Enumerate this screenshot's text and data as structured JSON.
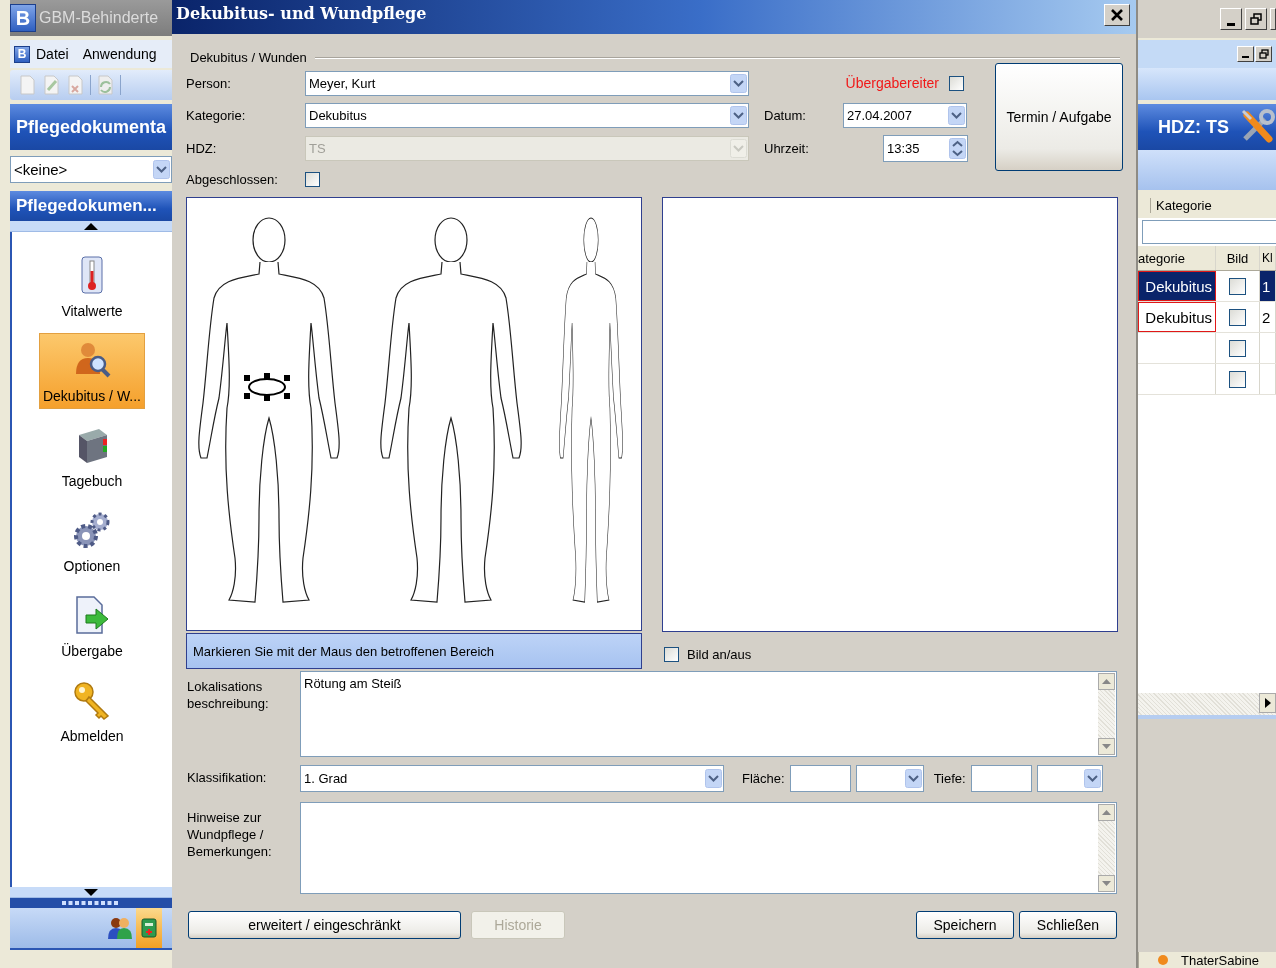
{
  "app": {
    "logo": "B",
    "title": "GBM-Behinderte",
    "menu_logo": "B",
    "menu": [
      {
        "label": "Datei"
      },
      {
        "label": "Anwendung"
      }
    ],
    "module_header": "Pflegedokumenta",
    "filter": {
      "value": "<keine>"
    },
    "nav_header": "Pflegedokumen...",
    "nav_items": [
      {
        "label": "Vitalwerte",
        "selected": false
      },
      {
        "label": "Dekubitus / W...",
        "selected": true
      },
      {
        "label": "Tagebuch",
        "selected": false
      },
      {
        "label": "Optionen",
        "selected": false
      },
      {
        "label": "Übergabe",
        "selected": false
      },
      {
        "label": "Abmelden",
        "selected": false
      }
    ]
  },
  "right_panel": {
    "header": "HDZ: TS",
    "group_column": "Kategorie",
    "columns": [
      "ategorie",
      "Bild",
      "Kl"
    ],
    "rows": [
      {
        "cells": [
          "Dekubitus",
          "1"
        ],
        "bild": false,
        "selected": true,
        "marked": true
      },
      {
        "cells": [
          "Dekubitus",
          "2"
        ],
        "bild": false,
        "selected": false,
        "marked": true
      },
      {
        "cells": [
          "",
          ""
        ],
        "bild": false,
        "selected": false,
        "marked": false
      },
      {
        "cells": [
          "",
          ""
        ],
        "bild": false,
        "selected": false,
        "marked": false
      }
    ],
    "status_user": "ThaterSabine"
  },
  "dialog": {
    "title": "Dekubitus- und Wundpflege",
    "section": "Dekubitus / Wunden",
    "person": {
      "label": "Person:",
      "value": "Meyer, Kurt"
    },
    "kategorie": {
      "label": "Kategorie:",
      "value": "Dekubitus"
    },
    "hdz": {
      "label": "HDZ:",
      "value": "TS",
      "disabled": true
    },
    "abgeschlossen": {
      "label": "Abgeschlossen:",
      "checked": false
    },
    "uebergabe": {
      "label": "Übergabereiter",
      "checked": false
    },
    "datum": {
      "label": "Datum:",
      "value": "27.04.2007"
    },
    "uhrzeit": {
      "label": "Uhrzeit:",
      "value": "13:35"
    },
    "termin_button": "Termin / Aufgabe",
    "body_hint": "Markieren Sie mit der Maus den betroffenen Bereich",
    "bild_toggle": {
      "label": "Bild an/aus",
      "checked": false
    },
    "lokalisation": {
      "label": "Lokalisations beschreibung:",
      "value": "Rötung am Steiß"
    },
    "klassifikation": {
      "label": "Klassifikation:",
      "value": "1. Grad"
    },
    "flaeche": {
      "label": "Fläche:"
    },
    "tiefe": {
      "label": "Tiefe:"
    },
    "hinweise": {
      "label": "Hinweise zur Wundpflege / Bemerkungen:"
    },
    "buttons": [
      {
        "label": "erweitert / eingeschränkt",
        "disabled": false
      },
      {
        "label": "Historie",
        "disabled": true
      },
      {
        "label": "Speichern",
        "disabled": false
      },
      {
        "label": "Schließen",
        "disabled": false
      }
    ]
  }
}
